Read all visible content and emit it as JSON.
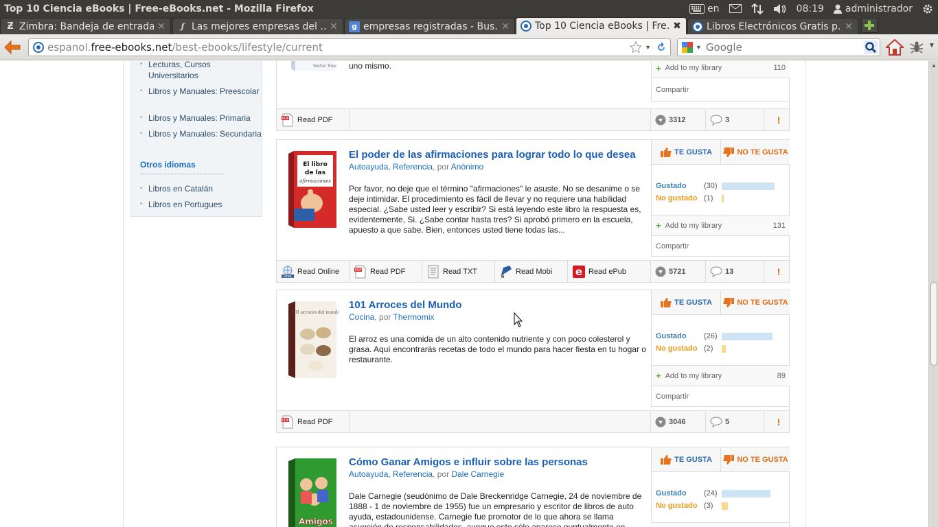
{
  "window": {
    "title": "Top 10 Ciencia eBooks | Free-eBooks.net - Mozilla Firefox",
    "tray": {
      "lang": "en",
      "time": "08:19",
      "user": "administrador"
    }
  },
  "tabs": [
    {
      "label": "Zimbra: Bandeja de entrada",
      "favicon": "zimbra-icon"
    },
    {
      "label": "Las mejores empresas del …",
      "favicon": "script-f-icon"
    },
    {
      "label": "empresas registradas - Bus…",
      "favicon": "google-icon"
    },
    {
      "label": "Top 10 Ciencia eBooks | Fre…",
      "favicon": "site-icon",
      "active": true
    },
    {
      "label": "Libros Electrónicos Gratis p…",
      "favicon": "site-icon"
    }
  ],
  "navbar": {
    "url_prefix": "espanol.",
    "url_domain": "free-ebooks.net",
    "url_path": "/best-ebooks/lifestyle/current",
    "search_placeholder": "Google"
  },
  "sidebar": {
    "items": [
      "Lecturas, Cursos Universitarios",
      "Libros y Manuales: Preescolar",
      "Libros y Manuales: Primaria",
      "Libros y Manuales: Secundaria"
    ],
    "other_heading": "Otros idiomas",
    "other_items": [
      "Libros en Catalán",
      "Libros en Portugues"
    ]
  },
  "top_partial": {
    "desc_tail": "uno mismo.",
    "add_library": "Add to my library",
    "library_count": "110",
    "share": "Compartir",
    "read_pdf": "Read PDF",
    "downloads": "3312",
    "comments": "3"
  },
  "labels": {
    "like": "TE GUSTA",
    "dislike": "NO TE GUSTA",
    "liked": "Gustado",
    "disliked": "No gustado",
    "add_library": "Add to my library",
    "share": "Compartir",
    "by": "por",
    "read_online": "Read Online",
    "read_pdf": "Read PDF",
    "read_txt": "Read TXT",
    "read_mobi": "Read Mobi",
    "read_epub": "Read ePub",
    "report": "!"
  },
  "books": [
    {
      "title": "El poder de las afirmaciones para lograr todo lo que desea",
      "categories": "Autoayuda, Referencia",
      "author": "Anónimo",
      "description": "Por favor, no deje que el término \"afirmaciones\" le asuste. No se desanime o se deje intimidar. El procedimiento es fácil de llevar y no requiere una habilidad especial. ¿Sabe usted leer y escribir? Si está leyendo este libro la respuesta es, evidentemente, Si. ¿Sabe contar hasta tres? Si aprobó primero en la escuela, apuesto a que sabe. Bien, entonces usted tiene todas las...",
      "liked_count": "(30)",
      "liked_fraction": 0.968,
      "disliked_count": "(1)",
      "disliked_fraction": 0.032,
      "library_count": "131",
      "downloads": "5721",
      "comments": "13",
      "formats": [
        "online",
        "pdf",
        "txt",
        "mobi",
        "epub"
      ],
      "cover_text": "El libro de las afirmaciones"
    },
    {
      "title": "101 Arroces del Mundo",
      "categories": "Cocina",
      "author": "Thermomix",
      "description": "El arroz es una comida de un alto contenido nutriente y con poco colesterol y grasa. Aquí encontrarás recetas de todo el mundo para hacer fiesta en tu hogar o restaurante.",
      "liked_count": "(26)",
      "liked_fraction": 0.929,
      "disliked_count": "(2)",
      "disliked_fraction": 0.071,
      "library_count": "89",
      "downloads": "3046",
      "comments": "5",
      "formats": [
        "pdf"
      ],
      "cover_text": "101 arroces del mundo"
    },
    {
      "title": "Cómo Ganar Amigos e influir sobre las personas",
      "categories": "Autoayuda, Referencia",
      "author": "Dale Carnegie",
      "description": "Dale Carnegie (seudónimo de Dale Breckenridge Carnegie, 24 de noviembre de 1888 - 1 de noviembre de 1955) fue un empresario y escritor de libros de auto ayuda, estadounidense. Carnegie fue promotor de lo que ahora se llama asunción de responsabilidades, aunque esto sólo aparece puntualmente en",
      "liked_count": "(24)",
      "liked_fraction": 0.889,
      "disliked_count": "(3)",
      "disliked_fraction": 0.111,
      "cover_text": "Amigos"
    }
  ]
}
